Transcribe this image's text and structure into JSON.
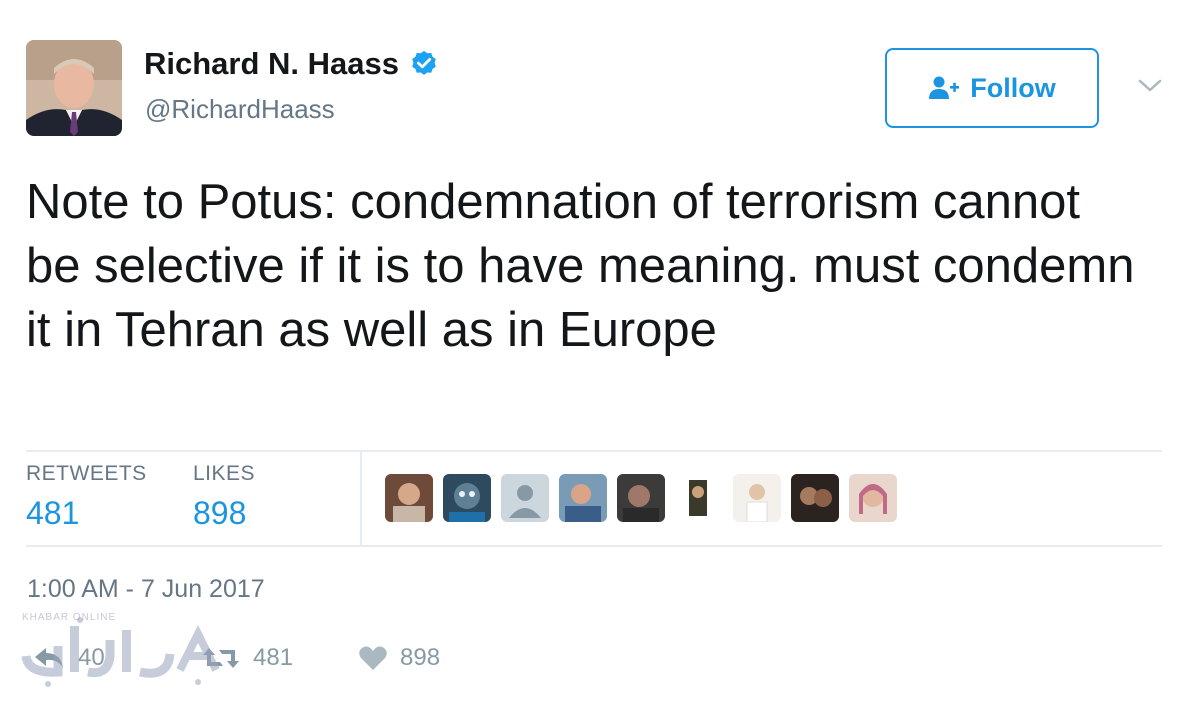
{
  "author": {
    "name": "Richard N. Haass",
    "handle": "@RichardHaass",
    "verified": true
  },
  "follow_button": {
    "label": "Follow",
    "icon": "add-user-icon"
  },
  "menu_icon": "chevron-down-icon",
  "tweet": {
    "text": "Note to Potus: condemnation of terrorism cannot be selective if it is to have meaning. must condemn it in Tehran as well as in Europe"
  },
  "stats": {
    "retweets_label": "RETWEETS",
    "retweets_value": "481",
    "likes_label": "LIKES",
    "likes_value": "898"
  },
  "likers_count": 9,
  "timestamp": "1:00 AM - 7 Jun 2017",
  "actions": {
    "reply_count": "40",
    "retweet_count": "481",
    "like_count": "898"
  },
  "watermark": {
    "caption": "KHABAR ONLINE",
    "logo": "watermark-logo"
  },
  "colors": {
    "accent": "#1b95e0",
    "secondary_text": "#657786",
    "divider": "#e6ecf0"
  }
}
